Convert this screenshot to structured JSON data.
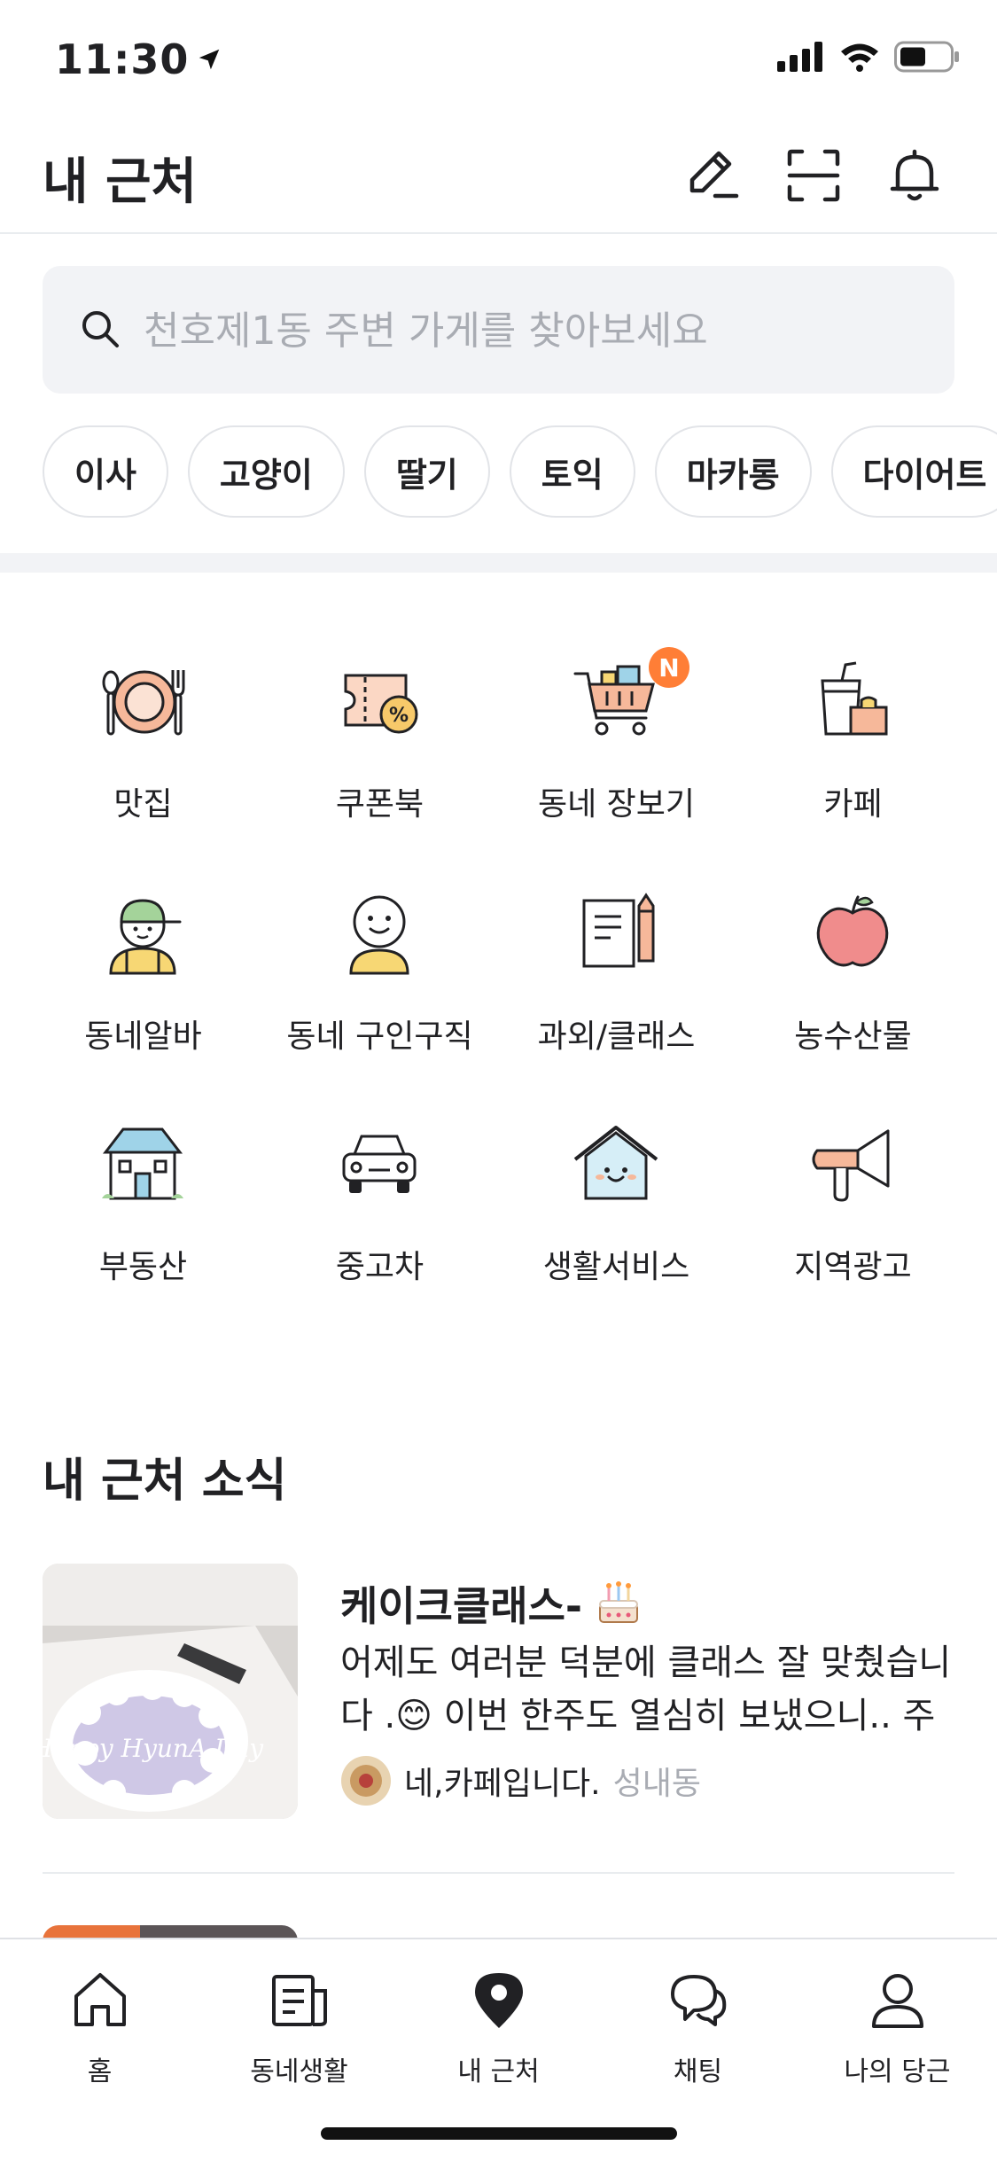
{
  "status_bar": {
    "time": "11:30"
  },
  "header": {
    "title": "내 근처"
  },
  "search": {
    "placeholder": "천호제1동 주변 가게를 찾아보세요"
  },
  "chips": [
    "이사",
    "고양이",
    "딸기",
    "토익",
    "마카롱",
    "다이어트"
  ],
  "categories": [
    {
      "label": "맛집",
      "icon": "plate-icon"
    },
    {
      "label": "쿠폰북",
      "icon": "coupon-icon"
    },
    {
      "label": "동네 장보기",
      "icon": "cart-icon",
      "badge": "N"
    },
    {
      "label": "카페",
      "icon": "cafe-cup-icon"
    },
    {
      "label": "동네알바",
      "icon": "worker-icon"
    },
    {
      "label": "동네 구인구직",
      "icon": "smiley-person-icon"
    },
    {
      "label": "과외/클래스",
      "icon": "notebook-pencil-icon"
    },
    {
      "label": "농수산물",
      "icon": "apple-icon"
    },
    {
      "label": "부동산",
      "icon": "building-icon"
    },
    {
      "label": "중고차",
      "icon": "car-icon"
    },
    {
      "label": "생활서비스",
      "icon": "house-icon"
    },
    {
      "label": "지역광고",
      "icon": "megaphone-icon"
    }
  ],
  "nearby_news": {
    "title": "내 근처 소식",
    "item": {
      "title": "케이크클래스-",
      "body": "어제도 여러분 덕분에 클래스 잘 맞췄습니다 .😊 이번 한주도 열심히 보냈으니.. 주말...",
      "store": "네,카페입니다.",
      "location": "성내동",
      "thumb_text": "Happy HyunA Day"
    }
  },
  "tabbar": [
    {
      "label": "홈",
      "icon": "home-icon"
    },
    {
      "label": "동네생활",
      "icon": "community-icon"
    },
    {
      "label": "내 근처",
      "icon": "location-pin-icon",
      "active": true
    },
    {
      "label": "채팅",
      "icon": "chat-icon"
    },
    {
      "label": "나의 당근",
      "icon": "person-icon"
    }
  ],
  "colors": {
    "accent": "#ff7e36",
    "text": "#212124",
    "muted": "#a9acb3",
    "surface": "#f2f3f6"
  }
}
